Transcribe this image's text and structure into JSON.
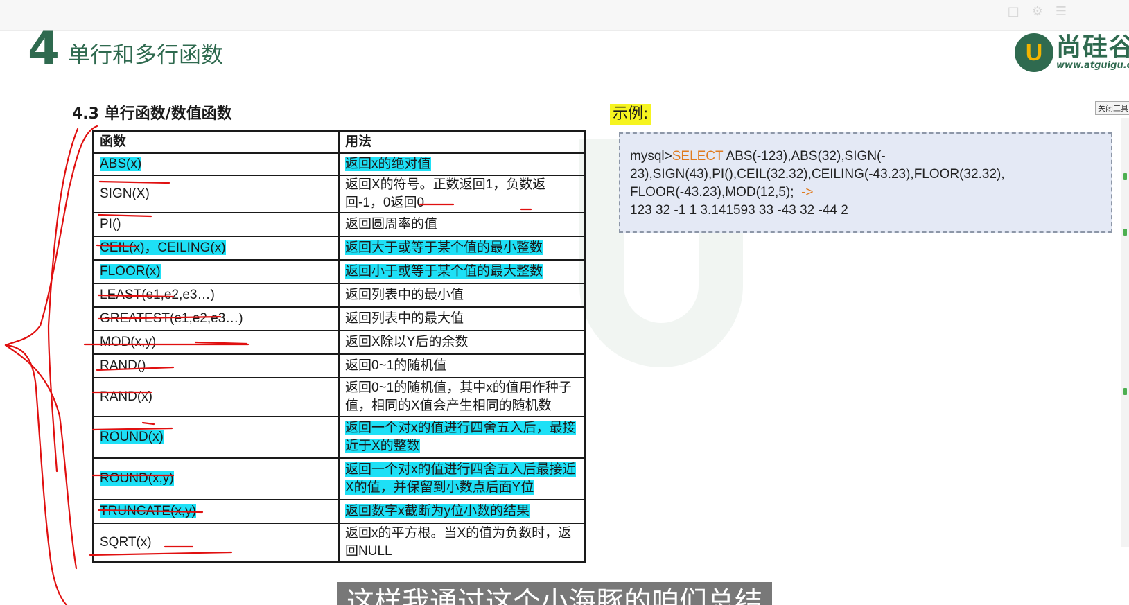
{
  "header": {
    "number": "4",
    "title": "单行和多行函数"
  },
  "logo": {
    "mark": "U",
    "name_cn": "尚硅谷",
    "url": "www.atguigu.com"
  },
  "side_toolbar": {
    "label": "关闭工具"
  },
  "section": {
    "title": "4.3 单行函数/数值函数"
  },
  "table": {
    "headers": [
      "函数",
      "用法"
    ],
    "rows": [
      {
        "func": "ABS(x)",
        "usage": "返回x的绝对值",
        "highlight": true
      },
      {
        "func": "SIGN(X)",
        "usage": "返回X的符号。正数返回1，负数返回-1，0返回0",
        "highlight": false
      },
      {
        "func": "PI()",
        "usage": "返回圆周率的值",
        "highlight": false
      },
      {
        "func": "CEIL(x)，CEILING(x)",
        "usage": "返回大于或等于某个值的最小整数",
        "highlight": true
      },
      {
        "func": "FLOOR(x)",
        "usage": "返回小于或等于某个值的最大整数",
        "highlight": true
      },
      {
        "func": "LEAST(e1,e2,e3…)",
        "usage": "返回列表中的最小值",
        "highlight": false
      },
      {
        "func": "GREATEST(e1,e2,e3…)",
        "usage": "返回列表中的最大值",
        "highlight": false
      },
      {
        "func": "MOD(x,y)",
        "usage": "返回X除以Y后的余数",
        "highlight": false
      },
      {
        "func": "RAND()",
        "usage": "返回0~1的随机值",
        "highlight": false
      },
      {
        "func": "RAND(x)",
        "usage": "返回0~1的随机值，其中x的值用作种子值，相同的X值会产生相同的随机数",
        "highlight": false
      },
      {
        "func": "ROUND(x)",
        "usage": "返回一个对x的值进行四舍五入后，最接近于X的整数",
        "highlight": true
      },
      {
        "func": "ROUND(x,y)",
        "usage": "返回一个对x的值进行四舍五入后最接近X的值，并保留到小数点后面Y位",
        "highlight": true
      },
      {
        "func": "TRUNCATE(x,y)",
        "usage": "返回数字x截断为y位小数的结果",
        "highlight": true
      },
      {
        "func": "SQRT(x)",
        "usage": "返回x的平方根。当X的值为负数时，返回NULL",
        "highlight": false
      }
    ]
  },
  "example": {
    "label": "示例:",
    "prompt": "mysql>",
    "keyword": "SELECT",
    "line1_rest": " ABS(-123),ABS(32),SIGN(-",
    "line2": "23),SIGN(43),PI(),CEIL(32.32),CEILING(-43.23),FLOOR(32.32),",
    "line3": "FLOOR(-43.23),MOD(12,5);",
    "arrow": "->",
    "result": "123  32  -1   1   3.141593   33  -43  32  -44   2"
  },
  "subtitle": {
    "text": "这样我通过这个小海豚的咱们总结"
  },
  "colors": {
    "brand_green": "#2f6a4f",
    "highlight_cyan": "#1ee0f6",
    "label_yellow": "#f6f420",
    "keyword_orange": "#e07b1f",
    "ink_red": "#e01010"
  }
}
